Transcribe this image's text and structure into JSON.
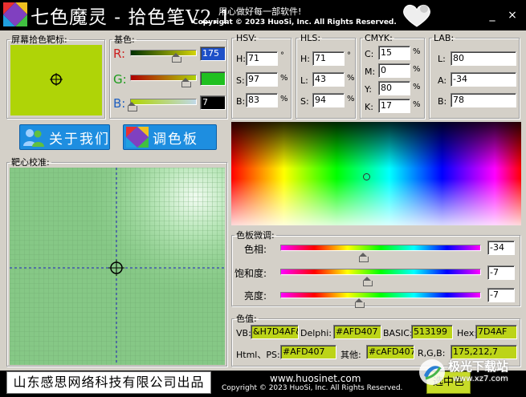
{
  "titlebar": {
    "title": "七色魔灵 - 拾色笔V2.1",
    "slogan": "用心做好每一部软件!",
    "copyright": "Copyright © 2023 HuoSi, Inc. All Rights Reserved.",
    "minimize": "_",
    "close": "×"
  },
  "screen_target": {
    "legend": "屏幕拾色靶标:",
    "swatch_color": "#AFD407"
  },
  "base": {
    "legend": "基色:",
    "r_label": "R:",
    "g_label": "G:",
    "b_label": "B:",
    "r_value": "175",
    "g_value": "212",
    "b_value": "7",
    "r_level": 0.686,
    "g_level": 0.831,
    "b_level": 0.027,
    "r_color": "#cc2020",
    "g_color": "#1a9a1a",
    "b_color": "#2060c0"
  },
  "hsv": {
    "legend": "HSV:",
    "h_label": "H:",
    "s_label": "S:",
    "v_label": "B:",
    "h": "71",
    "s": "97",
    "v": "83",
    "h_unit": "°",
    "s_unit": "%",
    "v_unit": "%"
  },
  "hls": {
    "legend": "HLS:",
    "h_label": "H:",
    "l_label": "L:",
    "s_label": "S:",
    "h": "71",
    "l": "43",
    "s": "94",
    "h_unit": "°",
    "l_unit": "%",
    "s_unit": "%"
  },
  "cmyk": {
    "legend": "CMYK:",
    "c_label": "C:",
    "m_label": "M:",
    "y_label": "Y:",
    "k_label": "K:",
    "c": "15",
    "m": "0",
    "y": "80",
    "k": "17",
    "unit": "%"
  },
  "lab": {
    "legend": "LAB:",
    "l_label": "L:",
    "a_label": "A:",
    "b_label": "B:",
    "l": "80",
    "a": "-34",
    "b": "78"
  },
  "buttons": {
    "about": "关于我们",
    "palette": "调色板",
    "select": "选中色"
  },
  "magnifier": {
    "legend": "靶心校准:"
  },
  "adjust": {
    "legend": "色板微调:",
    "hue_label": "色相:",
    "sat_label": "饱和度:",
    "bri_label": "亮度:",
    "hue": "-34",
    "sat": "-7",
    "bri": "-7",
    "hue_level": 0.41,
    "sat_level": 0.43,
    "bri_level": 0.39
  },
  "values": {
    "legend": "色值:",
    "vb_label": "VB:",
    "vb": "&H7D4AF&",
    "delphi_label": "Delphi:",
    "delphi": "#AFD407",
    "basic_label": "BASIC:",
    "basic": "513199",
    "hex_label": "Hex:",
    "hex": "7D4AF",
    "html_label": "Html、PS:",
    "html": "#AFD407",
    "other_label": "其他:",
    "other": "#cAFD407",
    "rgb_label": "R,G,B:",
    "rgb": "175,212,7"
  },
  "footer": {
    "company": "山东感思网络科技有限公司出品",
    "website": "www.huosinet.com",
    "copyright": "Copyright © 2023 HuoSi, Inc. All Rights Reserved."
  },
  "watermark": {
    "text": "极光下载站",
    "url": "www.xz7.com"
  }
}
